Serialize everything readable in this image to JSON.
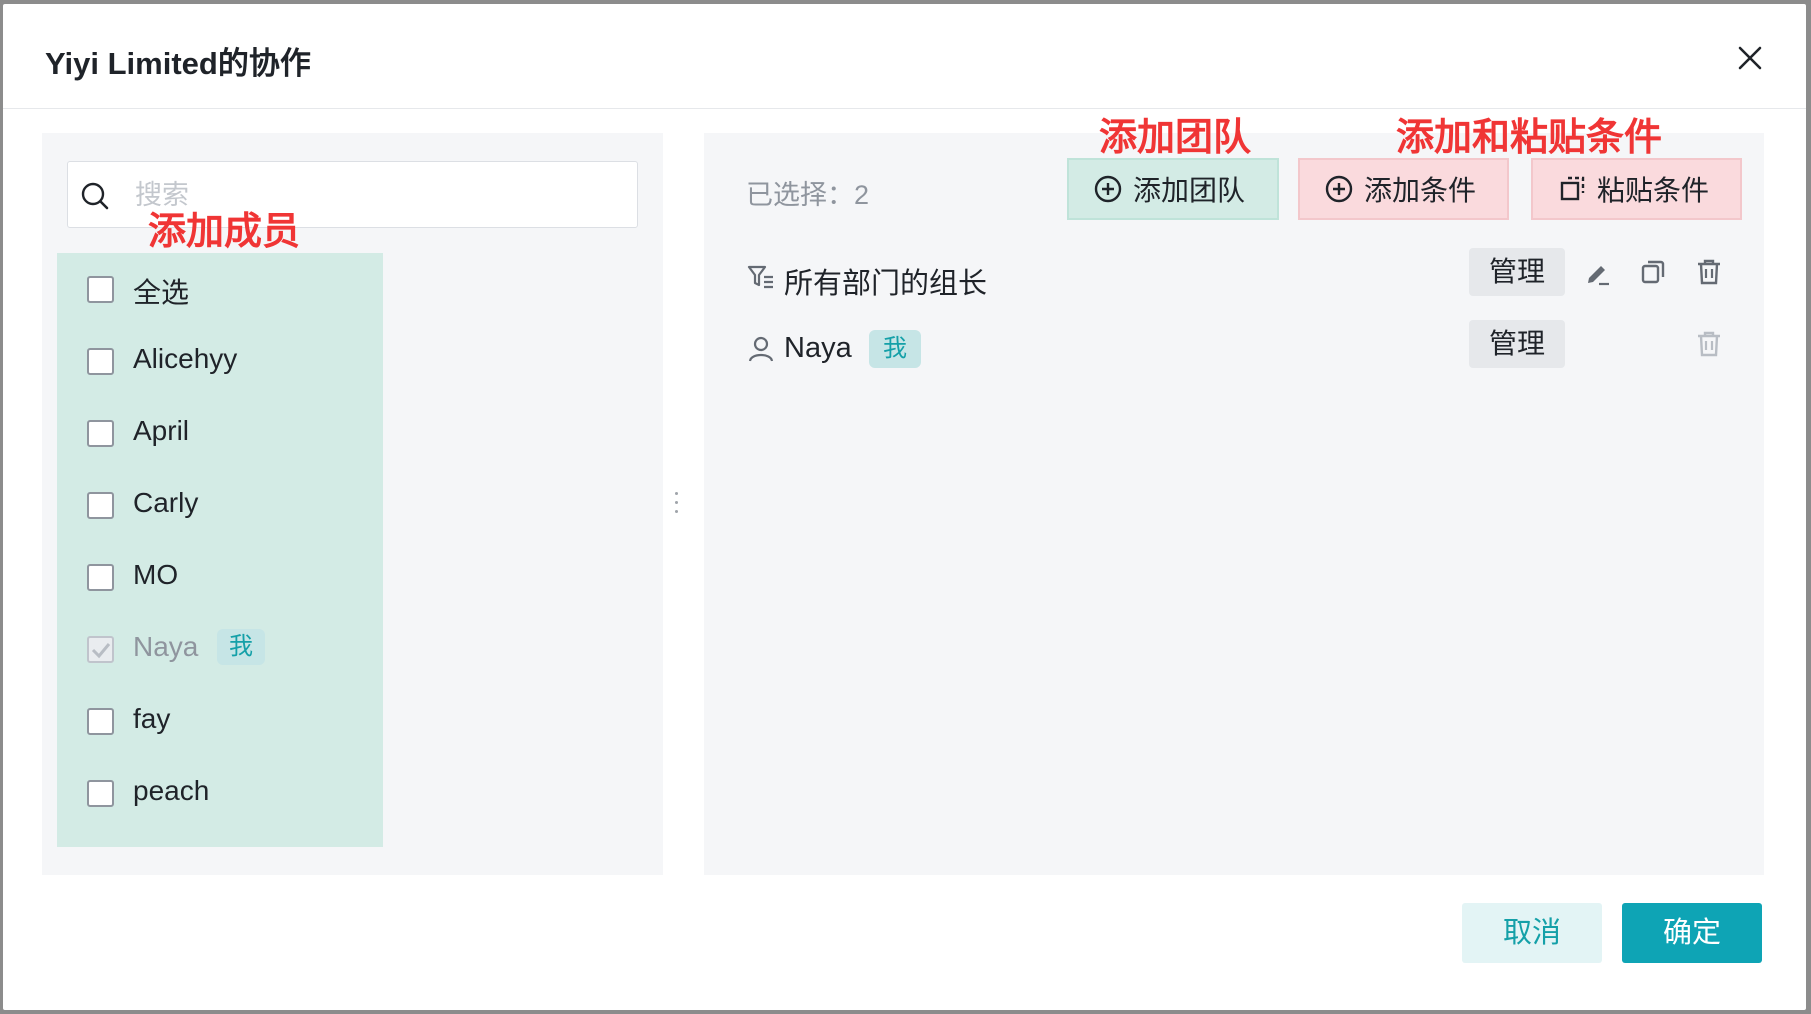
{
  "dialog": {
    "title": "Yiyi Limited的协作",
    "close_icon": "close-icon"
  },
  "search": {
    "placeholder": "搜索",
    "value": ""
  },
  "members": [
    {
      "name": "全选",
      "checked": false,
      "disabled": false
    },
    {
      "name": "Alicehyy",
      "checked": false,
      "disabled": false
    },
    {
      "name": "April",
      "checked": false,
      "disabled": false
    },
    {
      "name": "Carly",
      "checked": false,
      "disabled": false
    },
    {
      "name": "MO",
      "checked": false,
      "disabled": false
    },
    {
      "name": "Naya",
      "checked": true,
      "disabled": true,
      "tag": "我"
    },
    {
      "name": "fay",
      "checked": false,
      "disabled": false
    },
    {
      "name": "peach",
      "checked": false,
      "disabled": false
    }
  ],
  "annotations": {
    "add_member": "添加成员",
    "add_team": "添加团队",
    "add_paste_condition": "添加和粘贴条件"
  },
  "right": {
    "selected_label": "已选择：2",
    "add_team_label": "添加团队",
    "add_condition_label": "添加条件",
    "paste_condition_label": "粘贴条件"
  },
  "permissions": [
    {
      "name": "所有部门的组长",
      "icon": "filter-icon",
      "manage": "管理",
      "actions": [
        "edit-icon",
        "copy-icon",
        "delete-icon"
      ]
    },
    {
      "name": "Naya",
      "icon": "user-icon",
      "tag": "我",
      "manage": "管理",
      "actions": [
        "delete-icon"
      ]
    }
  ],
  "footer": {
    "cancel_label": "取消",
    "confirm_label": "确定"
  },
  "colors": {
    "accent": "#0ea4b5",
    "annotation": "#f03535",
    "team_highlight": "#d3ebe5",
    "condition_highlight": "#fadadd"
  }
}
